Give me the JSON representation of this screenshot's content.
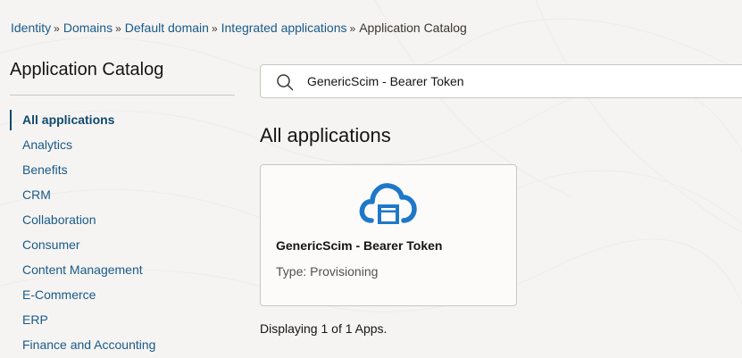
{
  "breadcrumb": {
    "items": [
      "Identity",
      "Domains",
      "Default domain",
      "Integrated applications"
    ],
    "separator": "»",
    "current": "Application Catalog"
  },
  "sidebar": {
    "title": "Application Catalog",
    "items": [
      {
        "label": "All applications",
        "active": true
      },
      {
        "label": "Analytics"
      },
      {
        "label": "Benefits"
      },
      {
        "label": "CRM"
      },
      {
        "label": "Collaboration"
      },
      {
        "label": "Consumer"
      },
      {
        "label": "Content Management"
      },
      {
        "label": "E-Commerce"
      },
      {
        "label": "ERP"
      },
      {
        "label": "Finance and Accounting"
      }
    ]
  },
  "search": {
    "icon": "search-icon",
    "value": "GenericScim - Bearer Token"
  },
  "main": {
    "title": "All applications",
    "apps": [
      {
        "icon": "cloud-app-icon",
        "name": "GenericScim - Bearer Token",
        "type": "Type: Provisioning"
      }
    ],
    "count_text": "Displaying 1 of 1 Apps."
  },
  "colors": {
    "link": "#1a5a8a",
    "active_nav": "#11496e",
    "icon_blue": "#1e78c8",
    "background": "#f5f4f2"
  }
}
